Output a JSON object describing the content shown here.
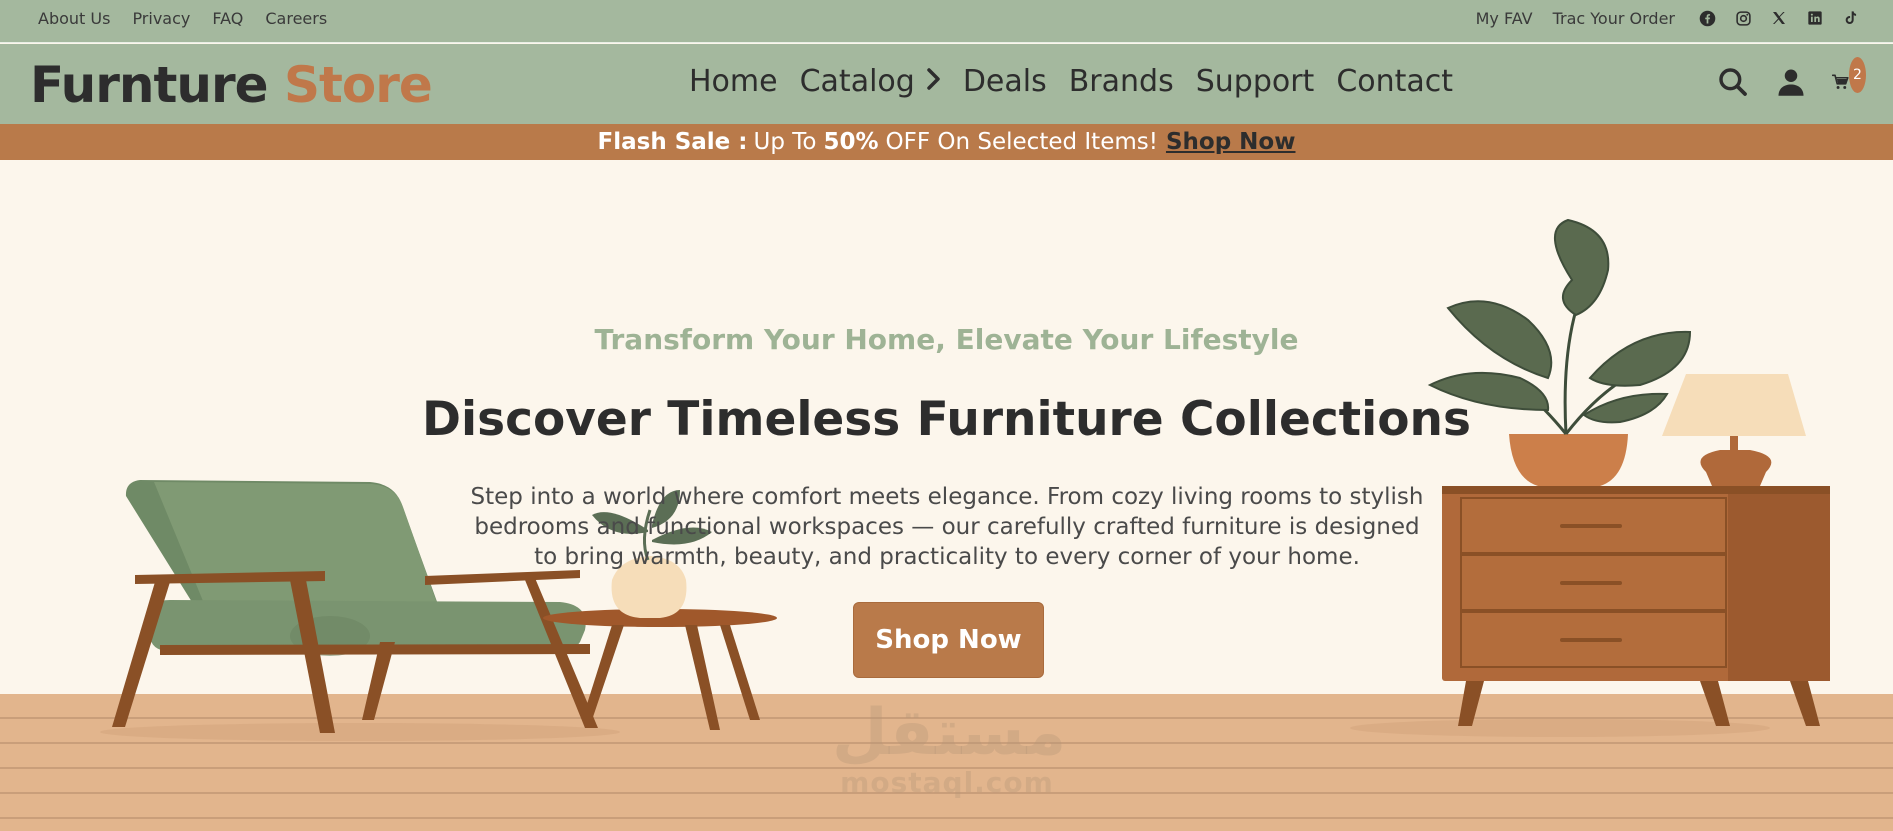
{
  "topbar": {
    "links": [
      "About Us",
      "Privacy",
      "FAQ",
      "Careers"
    ],
    "my_fav": "My FAV",
    "track_order": "Trac Your Order",
    "socials": [
      "facebook-icon",
      "instagram-icon",
      "x-icon",
      "linkedin-icon",
      "tiktok-icon"
    ]
  },
  "nav": {
    "logo_part1": "Furnture",
    "logo_part2": "Store",
    "menu": [
      "Home",
      "Catalog",
      "Deals",
      "Brands",
      "Support",
      "Contact"
    ],
    "cart_count": "2",
    "icons": [
      "search-icon",
      "user-icon",
      "cart-icon"
    ]
  },
  "flash": {
    "label": "Flash Sale :",
    "text1": "Up To",
    "percent": "50%",
    "text2": "OFF On Selected Items!",
    "link": "Shop Now"
  },
  "hero": {
    "tagline": "Transform Your Home, Elevate Your Lifestyle",
    "headline": "Discover Timeless Furniture Collections",
    "description": "Step into a world where comfort meets elegance. From cozy living rooms to stylish bedrooms and functional workspaces — our carefully crafted furniture is designed to bring warmth, beauty, and practicality to every corner of your home.",
    "cta": "Shop Now"
  },
  "watermark": {
    "arabic": "مستقل",
    "latin": "mostaql.com"
  },
  "colors": {
    "nav_bg": "#a4b89e",
    "accent": "#b97a4a",
    "brand_orange": "#c0784a",
    "hero_bg": "#fcf6ec",
    "floor": "#e2b58d"
  }
}
